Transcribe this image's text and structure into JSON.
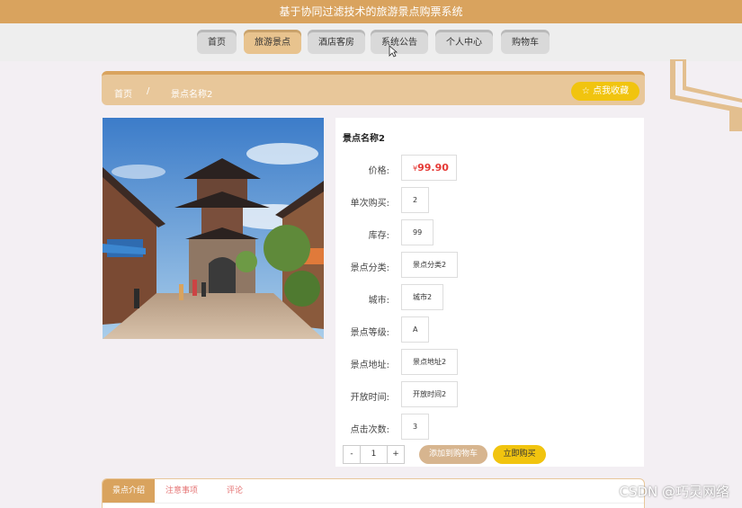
{
  "app": {
    "title": "基于协同过滤技术的旅游景点购票系统"
  },
  "nav": {
    "items": [
      {
        "label": "首页"
      },
      {
        "label": "旅游景点"
      },
      {
        "label": "酒店客房"
      },
      {
        "label": "系统公告"
      },
      {
        "label": "个人中心"
      },
      {
        "label": "购物车"
      }
    ],
    "active_index": 1
  },
  "breadcrumb": {
    "home": "首页",
    "separator": "/",
    "current": "景点名称2"
  },
  "favorite_button": {
    "icon": "star-icon",
    "label": "☆ 点我收藏"
  },
  "detail": {
    "title": "景点名称2",
    "price": {
      "label": "价格:",
      "currency": "¥",
      "value": "99.90"
    },
    "fields": [
      {
        "label": "单次购买:",
        "value": "2"
      },
      {
        "label": "库存:",
        "value": "99"
      },
      {
        "label": "景点分类:",
        "value": "景点分类2"
      },
      {
        "label": "城市:",
        "value": "城市2"
      },
      {
        "label": "景点等级:",
        "value": "A"
      },
      {
        "label": "景点地址:",
        "value": "景点地址2"
      },
      {
        "label": "开放时间:",
        "value": "开放时间2"
      },
      {
        "label": "点击次数:",
        "value": "3"
      }
    ],
    "quantity": {
      "minus": "-",
      "value": "1",
      "plus": "+"
    },
    "add_to_cart_label": "添加到购物车",
    "buy_now_label": "立即购买"
  },
  "tabs": [
    {
      "label": "景点介绍"
    },
    {
      "label": "注意事项"
    },
    {
      "label": "评论"
    }
  ],
  "watermark": "CSDN @巧灵网络",
  "colors": {
    "brand": "#d9a35e",
    "accent": "#f1c40f",
    "price": "#e53935"
  }
}
